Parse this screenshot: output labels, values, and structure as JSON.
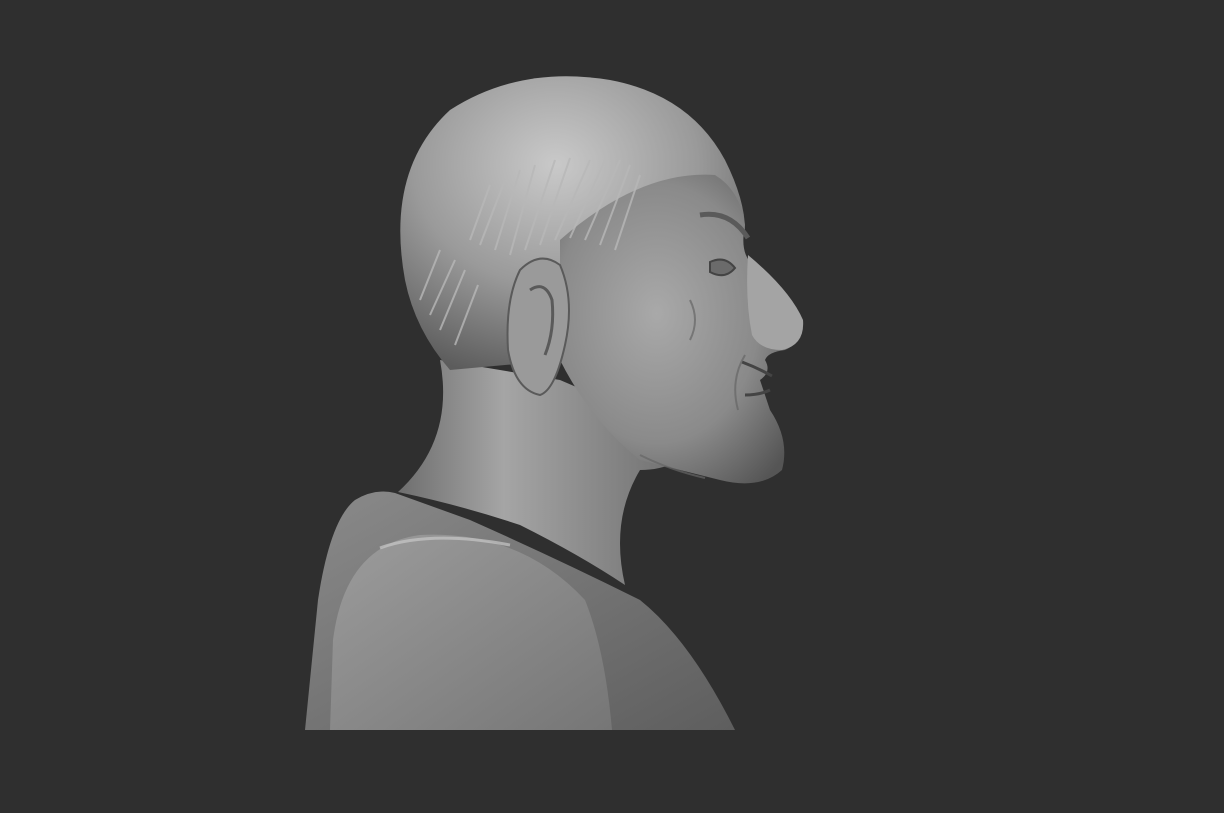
{
  "viewport": {
    "background_color": "#2f2f2f",
    "model": {
      "subject": "clay-bust-old-man-profile-right",
      "base_color": "#8e8e8e",
      "highlight_color": "#c4c4c4",
      "shadow_color": "#4a4a4a",
      "shading": "matcap-gray"
    }
  }
}
